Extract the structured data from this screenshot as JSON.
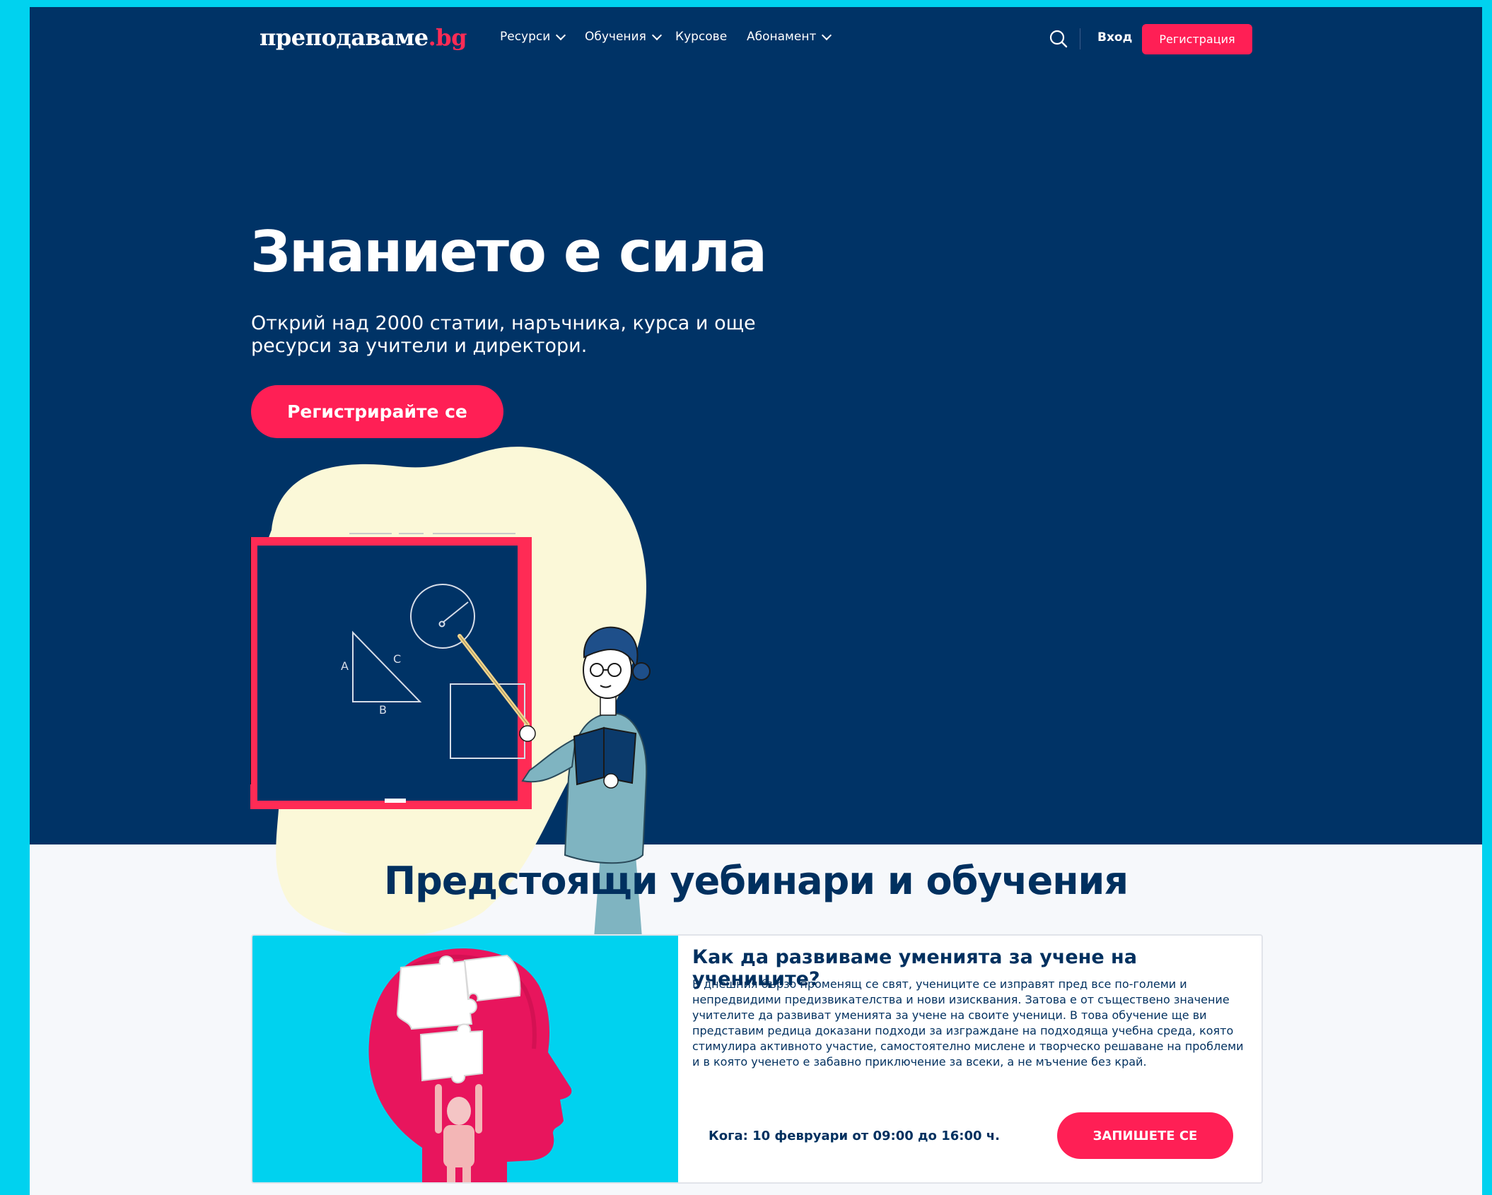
{
  "nav": {
    "logo_main": "преподаваме",
    "logo_tld": ".bg",
    "items": [
      {
        "label": "Ресурси"
      },
      {
        "label": "Обучения"
      },
      {
        "label": "Курсове"
      },
      {
        "label": "Абонамент"
      }
    ],
    "login_label": "Вход",
    "register_label": "Регистрация"
  },
  "hero": {
    "title": "Знанието е сила",
    "subtitle": "Открий над 2000 статии, наръчника, курса и още ресурси за учители и директори.",
    "cta_label": "Регистрирайте се",
    "board_labels": {
      "a": "A",
      "b": "B",
      "c": "C"
    }
  },
  "section": {
    "title": "Предстоящи уебинари и обучения"
  },
  "card": {
    "title": "Как да развиваме уменията за учене на учениците?",
    "description": "В днешния бързо променящ се свят, учениците се изправят пред все по-големи и непредвидими предизвикателства и нови изисквания. Затова е от съществено значение учителите да развиват уменията за учене на своите ученици. В това обучение ще ви представим редица доказани подходи за изграждане на подходяща учебна среда, която стимулира активното участие, самостоятелно мислене и творческо решаване на проблеми и в която ученето е забавно приключение за всеки, а не мъчение без край.",
    "when": "Кога: 10 февруари от 09:00 до 16:00 ч.",
    "signup_label": "ЗАПИШЕТЕ СЕ"
  },
  "colors": {
    "navy": "#003366",
    "accent": "#ff1f55",
    "frame": "#00d2ef",
    "blob": "#fbf8d8"
  }
}
